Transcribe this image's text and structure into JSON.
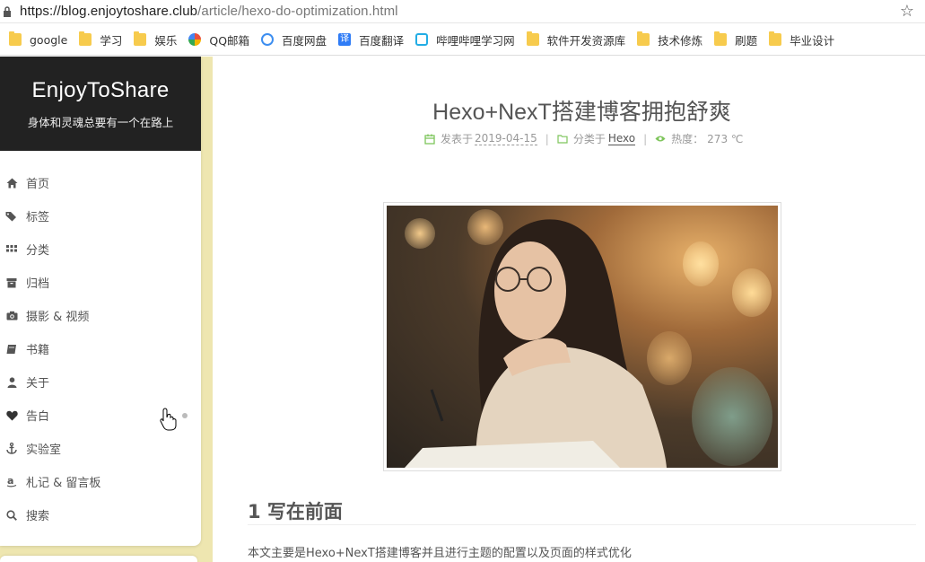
{
  "browser": {
    "url_host": "https://blog.enjoytoshare.club",
    "url_path": "/article/hexo-do-optimization.html",
    "bookmarks": [
      {
        "label": "google",
        "icon": "folder-icon"
      },
      {
        "label": "学习",
        "icon": "folder-icon"
      },
      {
        "label": "娱乐",
        "icon": "folder-icon"
      },
      {
        "label": "QQ邮箱",
        "icon": "qq-mail-icon"
      },
      {
        "label": "百度网盘",
        "icon": "baidu-pan-icon"
      },
      {
        "label": "百度翻译",
        "icon": "baidu-translate-icon"
      },
      {
        "label": "哔哩哔哩学习网",
        "icon": "bilibili-icon"
      },
      {
        "label": "软件开发资源库",
        "icon": "folder-icon"
      },
      {
        "label": "技术修炼",
        "icon": "folder-icon"
      },
      {
        "label": "刷题",
        "icon": "folder-icon"
      },
      {
        "label": "毕业设计",
        "icon": "folder-icon"
      }
    ]
  },
  "sidebar": {
    "site_title": "EnjoyToShare",
    "site_subtitle": "身体和灵魂总要有一个在路上",
    "menu": [
      {
        "label": "首页",
        "icon": "home-icon"
      },
      {
        "label": "标签",
        "icon": "tags-icon"
      },
      {
        "label": "分类",
        "icon": "grid-icon"
      },
      {
        "label": "归档",
        "icon": "archive-icon"
      },
      {
        "label": "摄影 & 视频",
        "icon": "camera-icon"
      },
      {
        "label": "书籍",
        "icon": "book-icon"
      },
      {
        "label": "关于",
        "icon": "user-icon"
      },
      {
        "label": "告白",
        "icon": "heart-icon"
      },
      {
        "label": "实验室",
        "icon": "anchor-icon"
      },
      {
        "label": "札记 & 留言板",
        "icon": "amazon-icon"
      },
      {
        "label": "搜索",
        "icon": "search-icon"
      }
    ]
  },
  "post": {
    "title": "Hexo+NexT搭建博客拥抱舒爽",
    "meta": {
      "posted_label": "发表于",
      "posted_date": "2019-04-15",
      "category_label": "分类于",
      "category": "Hexo",
      "views_label": "热度：",
      "views": "273 ℃"
    },
    "image_alt": "header-photo",
    "heading": "1 写在前面",
    "paragraph": "本文主要是Hexo+NexT搭建博客并且进行主题的配置以及页面的样式优化"
  },
  "colors": {
    "accent_green": "#7ec55c",
    "sidebar_header": "#222222",
    "page_bg": "#eee6b0"
  }
}
